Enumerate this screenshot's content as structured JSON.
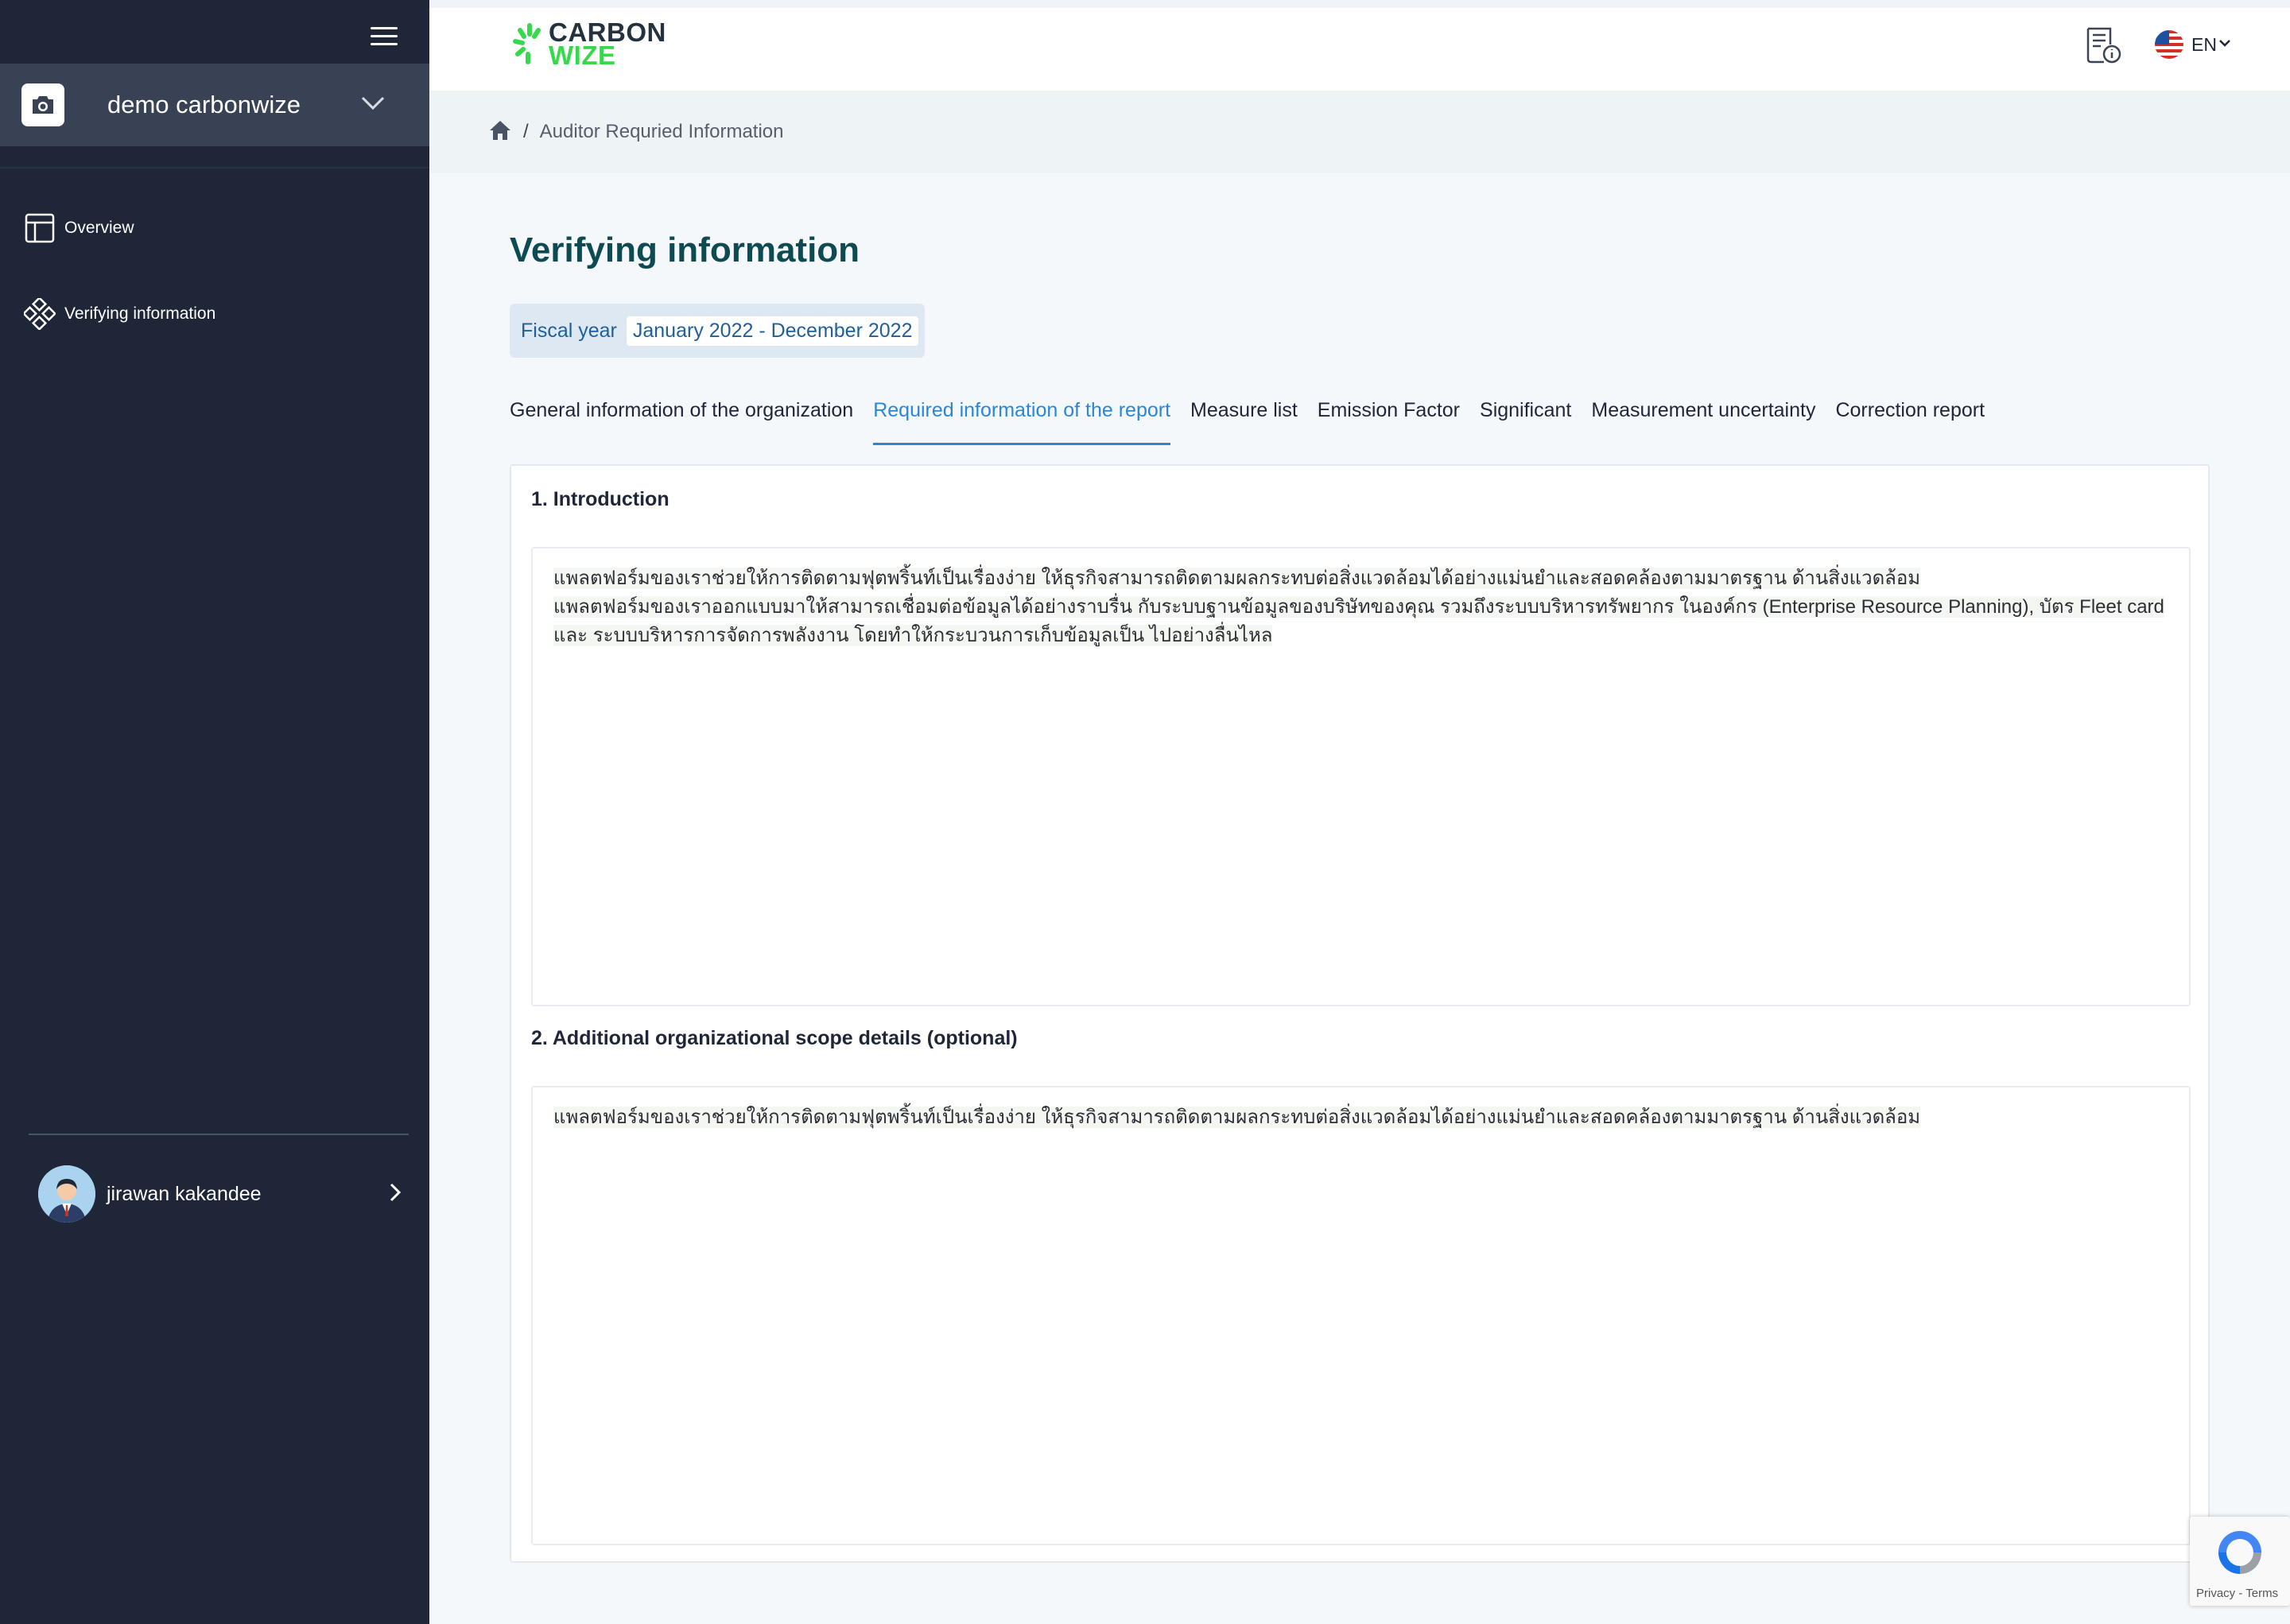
{
  "sidebar": {
    "org_name": "demo carbonwize",
    "nav": [
      {
        "label": "Overview"
      },
      {
        "label": "Verifying information"
      }
    ],
    "user_name": "jirawan kakandee"
  },
  "header": {
    "logo_line1": "CARBON",
    "logo_line2": "WIZE",
    "lang": "EN"
  },
  "breadcrumb": {
    "separator": "/",
    "current": "Auditor Requried Information"
  },
  "main": {
    "title": "Verifying information",
    "fiscal_label": "Fiscal year",
    "fiscal_value": "January 2022 - December 2022",
    "tabs": [
      {
        "label": "General information of the organization"
      },
      {
        "label": "Required information of the report"
      },
      {
        "label": "Measure list"
      },
      {
        "label": "Emission Factor"
      },
      {
        "label": "Significant"
      },
      {
        "label": "Measurement uncertainty"
      },
      {
        "label": "Correction report"
      }
    ],
    "section1": {
      "title": "1. Introduction",
      "lines": [
        "แพลตฟอร์มของเราช่วยให้การติดตามฟุตพริ้นท์เป็นเรื่องง่าย ให้ธุรกิจสามารถติดตามผลกระทบต่อสิ่งแวดล้อมได้อย่างแม่นยำและสอดคล้องตามมาตรฐาน ด้านสิ่งแวดล้อม",
        "แพลตฟอร์มของเราออกแบบมาให้สามารถเชื่อมต่อข้อมูลได้อย่างราบรื่น กับระบบฐานข้อมูลของบริษัทของคุณ รวมถึงระบบบริหารทรัพยากร ในองค์กร (Enterprise Resource Planning), บัตร Fleet card",
        "และ ระบบบริหารการจัดการพลังงาน โดยทำให้กระบวนการเก็บข้อมูลเป็น ไปอย่างลื่นไหล"
      ]
    },
    "section2": {
      "title": "2. Additional organizational scope details (optional)",
      "lines": [
        "แพลตฟอร์มของเราช่วยให้การติดตามฟุตพริ้นท์เป็นเรื่องง่าย ให้ธุรกิจสามารถติดตามผลกระทบต่อสิ่งแวดล้อมได้อย่างแม่นยำและสอดคล้องตามมาตรฐาน ด้านสิ่งแวดล้อม"
      ]
    }
  },
  "recaptcha": {
    "terms": "Privacy - Terms"
  }
}
